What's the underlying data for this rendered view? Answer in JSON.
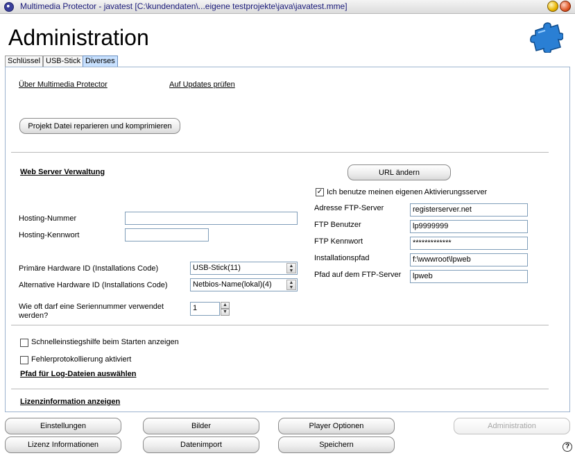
{
  "window": {
    "title": "Multimedia Protector - javatest [C:\\kundendaten\\...eigene testprojekte\\java\\javatest.mme]"
  },
  "page": {
    "title": "Administration"
  },
  "tabs": [
    {
      "label": "Schlüssel",
      "active": false
    },
    {
      "label": "USB-Stick",
      "active": false
    },
    {
      "label": "Diverses",
      "active": true
    }
  ],
  "top_links": {
    "about": "Über Multimedia Protector",
    "updates": "Auf Updates prüfen"
  },
  "repair_button": "Projekt Datei reparieren und komprimieren",
  "webserver": {
    "heading": "Web Server Verwaltung",
    "url_button": "URL ändern",
    "own_server_checkbox": {
      "label": "Ich benutze meinen eigenen Aktivierungsserver",
      "checked": true
    },
    "ftp_fields": [
      {
        "label": "Adresse FTP-Server",
        "value": "registerserver.net"
      },
      {
        "label": "FTP Benutzer",
        "value": "lp9999999"
      },
      {
        "label": "FTP Kennwort",
        "value": "*************"
      },
      {
        "label": "Installationspfad",
        "value": "f:\\wwwroot\\lpweb"
      },
      {
        "label": "Pfad auf dem FTP-Server",
        "value": "lpweb"
      }
    ],
    "hosting_number": {
      "label": "Hosting-Nummer",
      "value": ""
    },
    "hosting_password": {
      "label": "Hosting-Kennwort",
      "value": ""
    }
  },
  "hardware": {
    "primary": {
      "label": "Primäre Hardware ID (Installations Code)",
      "value": "USB-Stick(11)"
    },
    "alternative": {
      "label": "Alternative Hardware ID (Installations Code)",
      "value": "Netbios-Name(lokal)(4)"
    },
    "serial_usage": {
      "label": "Wie oft darf eine Seriennummer verwendet werden?",
      "value": "1"
    }
  },
  "options": {
    "quickstart": {
      "label": "Schnelleinstiegshilfe beim Starten anzeigen",
      "checked": false
    },
    "error_log": {
      "label": "Fehlerprotokollierung aktiviert",
      "checked": false
    },
    "log_path_link": "Pfad für Log-Dateien auswählen"
  },
  "license_link": "Lizenzinformation anzeigen",
  "bottom_buttons": {
    "settings": "Einstellungen",
    "images": "Bilder",
    "player_options": "Player Optionen",
    "administration": "Administration",
    "license_info": "Lizenz Informationen",
    "data_import": "Datenimport",
    "save": "Speichern"
  },
  "icons": {
    "app": "app-icon",
    "minimize": "minimize-icon",
    "close": "close-icon",
    "puzzle": "puzzle-icon",
    "help": "help-icon"
  },
  "colors": {
    "title_text": "#1a1a7a",
    "active_tab": "#c8e1ff",
    "puzzle": "#2a7fd4"
  }
}
